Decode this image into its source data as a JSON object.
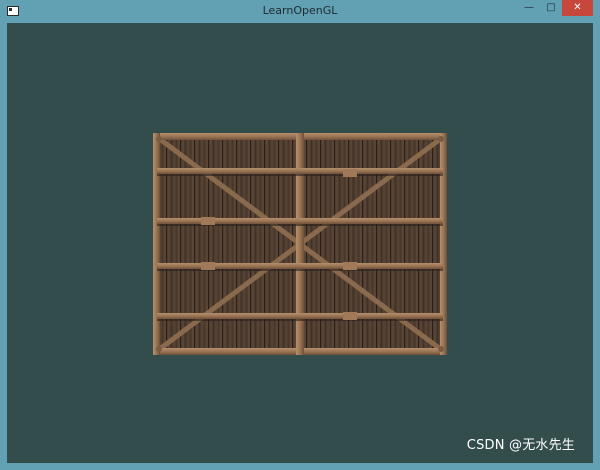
{
  "window": {
    "title": "LearnOpenGL",
    "controls": {
      "minimize": "—",
      "maximize": "□",
      "close": "✕"
    },
    "client_background": "#334d4d",
    "frame_color": "#62a0b4"
  },
  "scene": {
    "object": "wooden-crate-texture"
  },
  "watermark": {
    "text": "CSDN @无水先生"
  }
}
